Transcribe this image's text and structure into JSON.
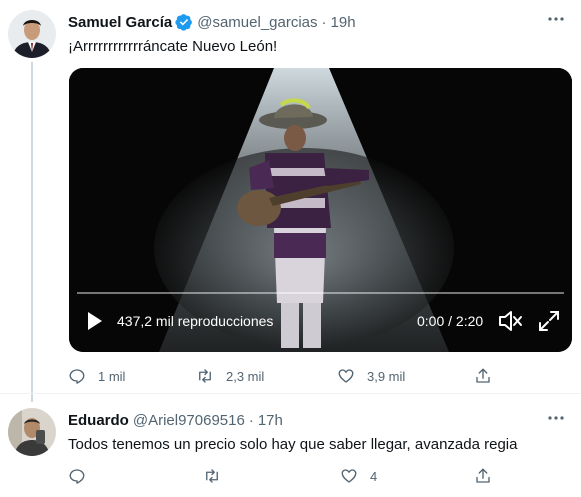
{
  "tweet": {
    "author_name": "Samuel García",
    "author_handle": "@samuel_garcias",
    "time": "19h",
    "text": "¡Arrrrrrrrrrrráncate Nuevo León!",
    "video": {
      "views": "437,2 mil reproducciones",
      "timecode": "0:00 / 2:20"
    },
    "actions": {
      "replies": "1 mil",
      "retweets": "2,3 mil",
      "likes": "3,9 mil"
    }
  },
  "reply": {
    "author_name": "Eduardo",
    "author_handle": "@Ariel97069516",
    "time": "17h",
    "text": "Todos tenemos un precio solo hay que saber llegar, avanzada regia",
    "actions": {
      "likes": "4"
    }
  },
  "colors": {
    "verified_blue": "#1d9bf0",
    "muted": "#536471",
    "text": "#0f1419"
  },
  "separator": "·"
}
